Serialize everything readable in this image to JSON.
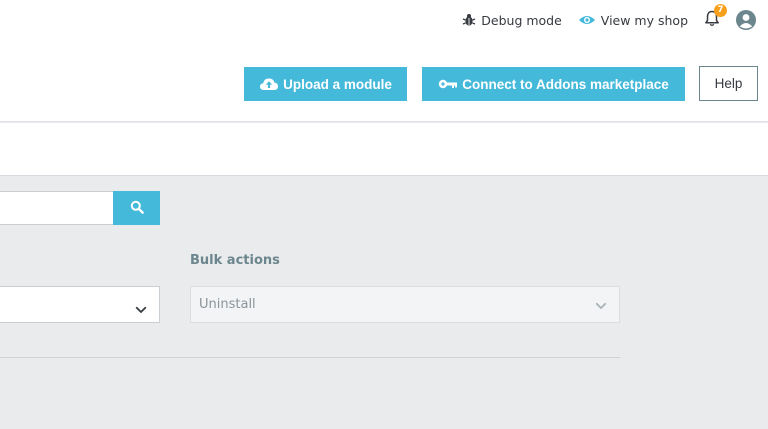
{
  "header": {
    "debug_mode": "Debug mode",
    "view_shop": "View my shop",
    "notification_count": "7"
  },
  "toolbar": {
    "upload_label": "Upload a module",
    "connect_label": "Connect to Addons marketplace",
    "help_label": "Help"
  },
  "filters": {
    "search_placeholder": "",
    "bulk_actions_label": "Bulk actions",
    "bulk_selected": "Uninstall"
  },
  "colors": {
    "accent": "#45b9d9",
    "badge": "#f8a01c",
    "background": "#eaebed"
  },
  "icons": [
    "bug-icon",
    "eye-icon",
    "bell-icon",
    "user-avatar-icon",
    "cloud-upload-icon",
    "key-icon",
    "search-icon",
    "chevron-down-icon"
  ]
}
